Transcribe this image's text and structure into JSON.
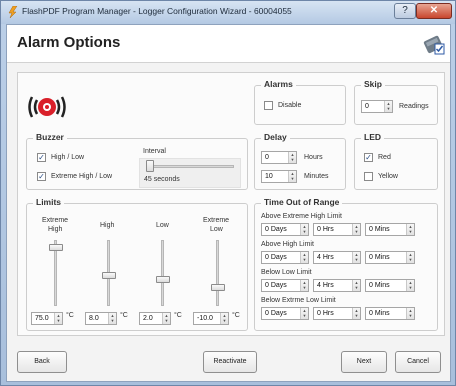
{
  "window": {
    "title": "FlashPDF Program Manager - Logger Configuration Wizard - 60004055",
    "help_glyph": "?",
    "close_glyph": "✕"
  },
  "page": {
    "title": "Alarm Options"
  },
  "alarms": {
    "title": "Alarms",
    "disable_label": "Disable",
    "disable_checked": false
  },
  "skip": {
    "title": "Skip",
    "value": "0",
    "unit_label": "Readings"
  },
  "buzzer": {
    "title": "Buzzer",
    "high_low_label": "High / Low",
    "high_low_checked": true,
    "extreme_label": "Extreme High / Low",
    "extreme_checked": true,
    "interval_label": "Interval",
    "interval_value": "45 seconds"
  },
  "delay": {
    "title": "Delay",
    "hours_value": "0",
    "hours_label": "Hours",
    "minutes_value": "10",
    "minutes_label": "Minutes"
  },
  "led": {
    "title": "LED",
    "red_label": "Red",
    "red_checked": true,
    "yellow_label": "Yellow",
    "yellow_checked": false
  },
  "limits": {
    "title": "Limits",
    "unit": "°C",
    "columns": [
      {
        "label_line1": "Extreme",
        "label_line2": "High",
        "value": "75.0"
      },
      {
        "label_line1": "High",
        "label_line2": "",
        "value": "8.0"
      },
      {
        "label_line1": "Low",
        "label_line2": "",
        "value": "2.0"
      },
      {
        "label_line1": "Extreme",
        "label_line2": "Low",
        "value": "-10.0"
      }
    ]
  },
  "time_out_of_range": {
    "title": "Time Out of Range",
    "rows": [
      {
        "label": "Above Extreme High Limit",
        "days": "0 Days",
        "hrs": "0 Hrs",
        "mins": "0 Mins"
      },
      {
        "label": "Above High Limit",
        "days": "0 Days",
        "hrs": "4 Hrs",
        "mins": "0 Mins"
      },
      {
        "label": "Below Low Limit",
        "days": "0 Days",
        "hrs": "4 Hrs",
        "mins": "0 Mins"
      },
      {
        "label": "Below Extrme Low Limit",
        "days": "0 Days",
        "hrs": "0 Hrs",
        "mins": "0 Mins"
      }
    ]
  },
  "footer": {
    "back": "Back",
    "reactivate": "Reactivate",
    "next": "Next",
    "cancel": "Cancel"
  },
  "icons": {
    "check_glyph": "✓",
    "spin_up": "▲",
    "spin_down": "▼"
  },
  "colors": {
    "alarm_red": "#d9202a",
    "title_bar": "#b4c9e3",
    "close_red": "#c8462e"
  }
}
